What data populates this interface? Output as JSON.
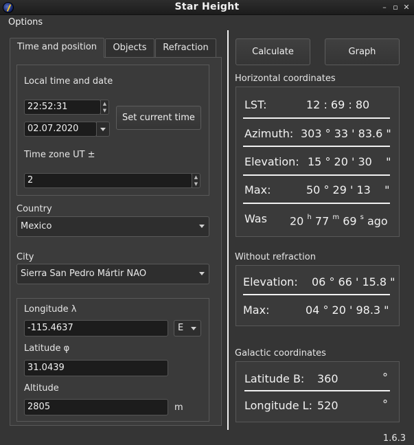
{
  "window": {
    "title": "Star Height",
    "min_icon": "minimize-icon",
    "max_icon": "maximize-icon",
    "close_icon": "close-icon",
    "min_glyph": "–",
    "max_glyph": "▫",
    "close_glyph": "✕"
  },
  "menu": {
    "options": "Options"
  },
  "tabs": [
    {
      "label": "Time and position",
      "active": true
    },
    {
      "label": "Objects",
      "active": false
    },
    {
      "label": "Refraction",
      "active": false
    }
  ],
  "time_group": {
    "title": "Local time and date",
    "time_value": "22:52:31",
    "date_value": "02.07.2020",
    "set_current_time": "Set current time",
    "timezone_label": "Time zone UT ±",
    "timezone_value": "2"
  },
  "location": {
    "country_label": "Country",
    "country_value": "Mexico",
    "city_label": "City",
    "city_value": "Sierra San Pedro Mártir NAO"
  },
  "coords_group": {
    "longitude_label": "Longitude λ",
    "longitude_value": "-115.4637",
    "longitude_dir": "E",
    "latitude_label": "Latitude φ",
    "latitude_value": "31.0439",
    "altitude_label": "Altitude",
    "altitude_value": "2805",
    "altitude_unit": "m"
  },
  "buttons": {
    "calculate": "Calculate",
    "graph": "Graph"
  },
  "horizontal": {
    "title": "Horizontal coordinates",
    "lst_label": "LST:",
    "lst_value": "12 : 69 : 80",
    "azimuth_label": "Azimuth:",
    "azimuth_value": "303 ° 33 ' 83.6 \"",
    "elevation_label": "Elevation:",
    "elevation_value": "15 ° 20 ' 30    \"",
    "max_label": "Max:",
    "max_value": "50 ° 29 ' 13    \"",
    "was_label": "Was",
    "was_h": "20",
    "was_h_unit": "h",
    "was_m": "77",
    "was_m_unit": "m",
    "was_s": "69",
    "was_s_unit": "s",
    "was_ago": "ago"
  },
  "without_refraction": {
    "title": "Without refraction",
    "elevation_label": "Elevation:",
    "elevation_value": "06 ° 66 ' 15.8 \"",
    "max_label": "Max:",
    "max_value": "04 ° 20 ' 98.3 \""
  },
  "galactic": {
    "title": "Galactic coordinates",
    "latitude_label": "Latitude B:",
    "latitude_value": "360",
    "latitude_unit": "°",
    "longitude_label": "Longitude L:",
    "longitude_value": "520",
    "longitude_unit": "°"
  },
  "version": "1.6.3"
}
